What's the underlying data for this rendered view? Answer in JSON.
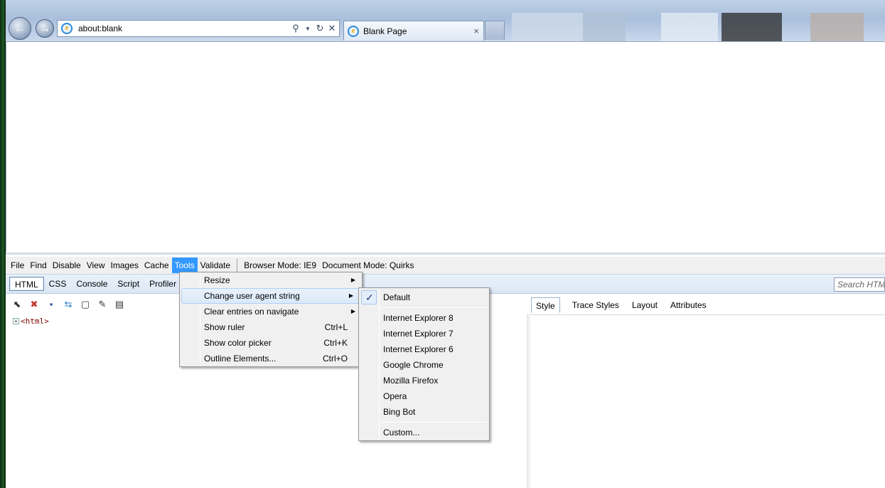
{
  "browser": {
    "address": "about:blank",
    "tab_title": "Blank Page",
    "nav": {
      "back": "←",
      "forward": "→"
    },
    "tab_close": "×",
    "address_tools": [
      "search-icon",
      "dropdown-icon",
      "refresh-icon",
      "stop-icon"
    ]
  },
  "devtools": {
    "menu": [
      "File",
      "Find",
      "Disable",
      "View",
      "Images",
      "Cache",
      "Tools",
      "Validate"
    ],
    "browser_mode": "Browser Mode: IE9",
    "document_mode": "Document Mode: Quirks",
    "tabs": [
      "HTML",
      "CSS",
      "Console",
      "Script",
      "Profiler"
    ],
    "search_placeholder": "Search HTML",
    "tree_node": "<html>",
    "tree_expand": "+",
    "right_tabs": [
      "Style",
      "Trace Styles",
      "Layout",
      "Attributes"
    ]
  },
  "tools_menu": {
    "items": [
      {
        "label": "Resize",
        "shortcut": "",
        "submenu": true
      },
      {
        "label": "Change user agent string",
        "shortcut": "",
        "submenu": true
      },
      {
        "label": "Clear entries on navigate",
        "shortcut": "",
        "submenu": true
      },
      {
        "label": "Show ruler",
        "shortcut": "Ctrl+L",
        "submenu": false
      },
      {
        "label": "Show color picker",
        "shortcut": "Ctrl+K",
        "submenu": false
      },
      {
        "label": "Outline Elements...",
        "shortcut": "Ctrl+O",
        "submenu": false
      }
    ]
  },
  "ua_menu": {
    "default": "Default",
    "check": "✓",
    "browsers": [
      "Internet Explorer 8",
      "Internet Explorer 7",
      "Internet Explorer 6",
      "Google Chrome",
      "Mozilla Firefox",
      "Opera",
      "Bing Bot"
    ],
    "custom": "Custom..."
  },
  "colors": {
    "menu_highlight": "#3399ff",
    "chrome": "#a9bfdc"
  }
}
